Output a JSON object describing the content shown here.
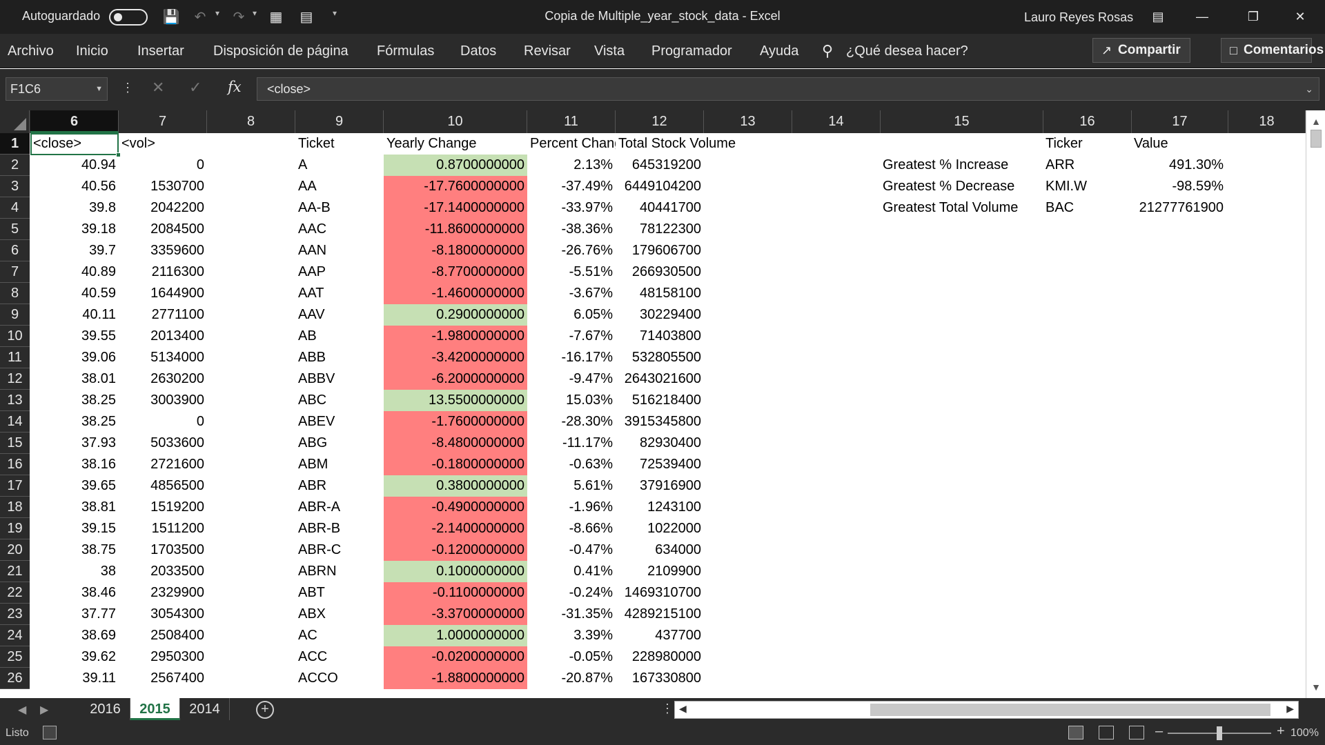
{
  "titlebar": {
    "autosave_label": "Autoguardado",
    "doc_title": "Copia de Multiple_year_stock_data  -  Excel",
    "user_name": "Lauro Reyes Rosas"
  },
  "ribbon": {
    "tabs": [
      "Archivo",
      "Inicio",
      "Insertar",
      "Disposición de página",
      "Fórmulas",
      "Datos",
      "Revisar",
      "Vista",
      "Programador",
      "Ayuda"
    ],
    "search_placeholder": "¿Qué desea hacer?",
    "share_label": "Compartir",
    "comments_label": "Comentarios"
  },
  "formula_bar": {
    "name_box": "F1C6",
    "fx_label": "fx",
    "formula": "<close>"
  },
  "columns": [
    "6",
    "7",
    "8",
    "9",
    "10",
    "11",
    "12",
    "13",
    "14",
    "15",
    "16",
    "17",
    "18"
  ],
  "rows": [
    {
      "num": "1",
      "close": "<close>",
      "vol": "<vol>",
      "ticket": "Ticket",
      "change": "Yearly Change",
      "pct": "Percent Change",
      "total": "Total Stock Volume"
    },
    {
      "num": "2",
      "close": "40.94",
      "vol": "0",
      "ticket": "A",
      "change": "0.8700000000",
      "pct": "2.13%",
      "total": "645319200"
    },
    {
      "num": "3",
      "close": "40.56",
      "vol": "1530700",
      "ticket": "AA",
      "change": "-17.7600000000",
      "pct": "-37.49%",
      "total": "6449104200"
    },
    {
      "num": "4",
      "close": "39.8",
      "vol": "2042200",
      "ticket": "AA-B",
      "change": "-17.1400000000",
      "pct": "-33.97%",
      "total": "40441700"
    },
    {
      "num": "5",
      "close": "39.18",
      "vol": "2084500",
      "ticket": "AAC",
      "change": "-11.8600000000",
      "pct": "-38.36%",
      "total": "78122300"
    },
    {
      "num": "6",
      "close": "39.7",
      "vol": "3359600",
      "ticket": "AAN",
      "change": "-8.1800000000",
      "pct": "-26.76%",
      "total": "179606700"
    },
    {
      "num": "7",
      "close": "40.89",
      "vol": "2116300",
      "ticket": "AAP",
      "change": "-8.7700000000",
      "pct": "-5.51%",
      "total": "266930500"
    },
    {
      "num": "8",
      "close": "40.59",
      "vol": "1644900",
      "ticket": "AAT",
      "change": "-1.4600000000",
      "pct": "-3.67%",
      "total": "48158100"
    },
    {
      "num": "9",
      "close": "40.11",
      "vol": "2771100",
      "ticket": "AAV",
      "change": "0.2900000000",
      "pct": "6.05%",
      "total": "30229400"
    },
    {
      "num": "10",
      "close": "39.55",
      "vol": "2013400",
      "ticket": "AB",
      "change": "-1.9800000000",
      "pct": "-7.67%",
      "total": "71403800"
    },
    {
      "num": "11",
      "close": "39.06",
      "vol": "5134000",
      "ticket": "ABB",
      "change": "-3.4200000000",
      "pct": "-16.17%",
      "total": "532805500"
    },
    {
      "num": "12",
      "close": "38.01",
      "vol": "2630200",
      "ticket": "ABBV",
      "change": "-6.2000000000",
      "pct": "-9.47%",
      "total": "2643021600"
    },
    {
      "num": "13",
      "close": "38.25",
      "vol": "3003900",
      "ticket": "ABC",
      "change": "13.5500000000",
      "pct": "15.03%",
      "total": "516218400"
    },
    {
      "num": "14",
      "close": "38.25",
      "vol": "0",
      "ticket": "ABEV",
      "change": "-1.7600000000",
      "pct": "-28.30%",
      "total": "3915345800"
    },
    {
      "num": "15",
      "close": "37.93",
      "vol": "5033600",
      "ticket": "ABG",
      "change": "-8.4800000000",
      "pct": "-11.17%",
      "total": "82930400"
    },
    {
      "num": "16",
      "close": "38.16",
      "vol": "2721600",
      "ticket": "ABM",
      "change": "-0.1800000000",
      "pct": "-0.63%",
      "total": "72539400"
    },
    {
      "num": "17",
      "close": "39.65",
      "vol": "4856500",
      "ticket": "ABR",
      "change": "0.3800000000",
      "pct": "5.61%",
      "total": "37916900"
    },
    {
      "num": "18",
      "close": "38.81",
      "vol": "1519200",
      "ticket": "ABR-A",
      "change": "-0.4900000000",
      "pct": "-1.96%",
      "total": "1243100"
    },
    {
      "num": "19",
      "close": "39.15",
      "vol": "1511200",
      "ticket": "ABR-B",
      "change": "-2.1400000000",
      "pct": "-8.66%",
      "total": "1022000"
    },
    {
      "num": "20",
      "close": "38.75",
      "vol": "1703500",
      "ticket": "ABR-C",
      "change": "-0.1200000000",
      "pct": "-0.47%",
      "total": "634000"
    },
    {
      "num": "21",
      "close": "38",
      "vol": "2033500",
      "ticket": "ABRN",
      "change": "0.1000000000",
      "pct": "0.41%",
      "total": "2109900"
    },
    {
      "num": "22",
      "close": "38.46",
      "vol": "2329900",
      "ticket": "ABT",
      "change": "-0.1100000000",
      "pct": "-0.24%",
      "total": "1469310700"
    },
    {
      "num": "23",
      "close": "37.77",
      "vol": "3054300",
      "ticket": "ABX",
      "change": "-3.3700000000",
      "pct": "-31.35%",
      "total": "4289215100"
    },
    {
      "num": "24",
      "close": "38.69",
      "vol": "2508400",
      "ticket": "AC",
      "change": "1.0000000000",
      "pct": "3.39%",
      "total": "437700"
    },
    {
      "num": "25",
      "close": "39.62",
      "vol": "2950300",
      "ticket": "ACC",
      "change": "-0.0200000000",
      "pct": "-0.05%",
      "total": "228980000"
    },
    {
      "num": "26",
      "close": "39.11",
      "vol": "2567400",
      "ticket": "ACCO",
      "change": "-1.8800000000",
      "pct": "-20.87%",
      "total": "167330800"
    }
  ],
  "summary": {
    "header_ticker": "Ticker",
    "header_value": "Value",
    "rows": [
      {
        "label": "Greatest % Increase",
        "ticker": "ARR",
        "value": "491.30%"
      },
      {
        "label": "Greatest % Decrease",
        "ticker": "KMI.W",
        "value": "-98.59%"
      },
      {
        "label": "Greatest Total Volume",
        "ticker": "BAC",
        "value": "21277761900"
      }
    ]
  },
  "sheets": [
    "2016",
    "2015",
    "2014"
  ],
  "active_sheet": "2015",
  "status": {
    "ready_label": "Listo",
    "zoom": "100%"
  },
  "colors": {
    "positive_fill": "#c6e0b4",
    "negative_fill": "#ff7f7f",
    "accent": "#217346"
  }
}
